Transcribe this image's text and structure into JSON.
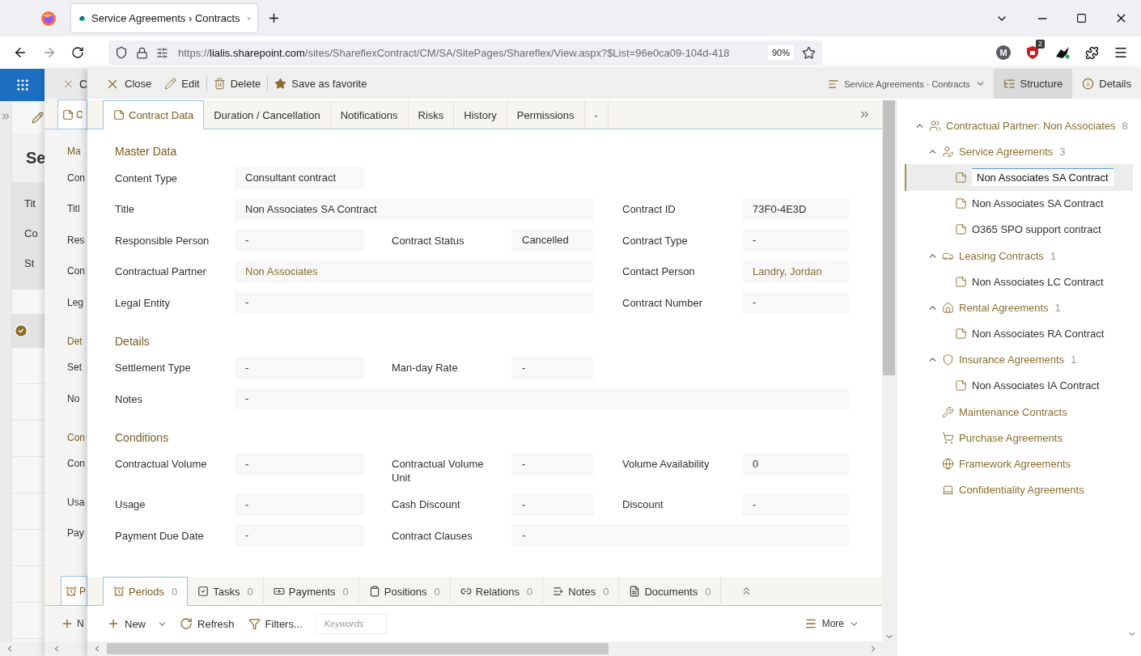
{
  "browser": {
    "tab": {
      "title": "Service Agreements › Contracts",
      "selected": true
    },
    "url": {
      "scheme": "https://",
      "host": "lialis.sharepoint.com",
      "path": "/sites/ShareflexContract/CM/SA/SitePages/Shareflex/View.aspx?$List=96e0ca09-104d-418"
    },
    "zoom": "90%",
    "profile_initial": "M",
    "blocker_count": "2"
  },
  "back_layer": {
    "heading": "Se",
    "rows": [
      "Tit",
      "Co",
      "St"
    ]
  },
  "middle_layer": {
    "toolbar_button": "C",
    "tab": "C",
    "lines": [
      {
        "kind": "heading",
        "text": "Ma"
      },
      {
        "kind": "label",
        "text": "Con"
      },
      {
        "kind": "label",
        "text": "Titl"
      },
      {
        "kind": "label",
        "text": "Res"
      },
      {
        "kind": "label",
        "text": "Con"
      },
      {
        "kind": "label",
        "text": "Leg"
      },
      {
        "kind": "heading",
        "text": "Det"
      },
      {
        "kind": "label",
        "text": "Set"
      },
      {
        "kind": "label",
        "text": "No"
      },
      {
        "kind": "heading",
        "text": "Con"
      },
      {
        "kind": "tall",
        "text": "Con"
      },
      {
        "kind": "label",
        "text": "Usa"
      },
      {
        "kind": "label",
        "text": "Pay"
      }
    ],
    "bottom_tab": "P",
    "new_button": "N"
  },
  "toolbar": {
    "actions": [
      {
        "label": "Close"
      },
      {
        "label": "Edit"
      },
      {
        "label": "Delete"
      },
      {
        "label": "Save as favorite"
      }
    ],
    "view_picker": "Service Agreements · Contracts",
    "panes": [
      {
        "label": "Structure",
        "selected": true
      },
      {
        "label": "Details",
        "selected": false
      }
    ]
  },
  "form_tabs": [
    {
      "label": "Contract Data",
      "selected": true
    },
    {
      "label": "Duration / Cancellation",
      "selected": false
    },
    {
      "label": "Notifications",
      "selected": false
    },
    {
      "label": "Risks",
      "selected": false
    },
    {
      "label": "History",
      "selected": false
    },
    {
      "label": "Permissions",
      "selected": false
    },
    {
      "label": "-",
      "selected": false
    }
  ],
  "sections": [
    {
      "title": "Master Data",
      "rows": [
        [
          {
            "label": "Content Type",
            "value": "Consultant contract",
            "kind": "narrow",
            "link": false
          }
        ],
        [
          {
            "label": "Title",
            "value": "Non Associates SA Contract",
            "kind": "wide",
            "link": false
          },
          {
            "label": "Contract ID",
            "value": "73F0-4E3D",
            "kind": "narrow",
            "link": false
          }
        ],
        [
          {
            "label": "Responsible Person",
            "value": "-",
            "kind": "narrow",
            "link": false
          },
          {
            "label": "Contract Status",
            "value": "Cancelled",
            "kind": "narrow",
            "link": false
          },
          {
            "label": "Contract Type",
            "value": "-",
            "kind": "narrow",
            "link": false
          }
        ],
        [
          {
            "label": "Contractual Partner",
            "value": "Non Associates",
            "kind": "wide",
            "link": true
          },
          {
            "label": "Contact Person",
            "value": "Landry, Jordan",
            "kind": "narrow",
            "link": true
          }
        ],
        [
          {
            "label": "Legal Entity",
            "value": "-",
            "kind": "wide",
            "link": false
          },
          {
            "label": "Contract Number",
            "value": "-",
            "kind": "narrow",
            "link": false
          }
        ]
      ]
    },
    {
      "title": "Details",
      "rows": [
        [
          {
            "label": "Settlement Type",
            "value": "-",
            "kind": "narrow",
            "link": false
          },
          {
            "label": "Man-day Rate",
            "value": "-",
            "kind": "narrow",
            "link": false
          }
        ],
        [
          {
            "label": "Notes",
            "value": "-",
            "kind": "full",
            "link": false
          }
        ]
      ]
    },
    {
      "title": "Conditions",
      "rows": [
        [
          {
            "label": "Contractual Volume",
            "value": "-",
            "kind": "narrow",
            "link": false
          },
          {
            "label": "Contractual Volume Unit",
            "value": "-",
            "kind": "narrow",
            "link": false
          },
          {
            "label": "Volume Availability",
            "value": "0",
            "kind": "narrow",
            "link": false
          }
        ],
        [
          {
            "label": "Usage",
            "value": "-",
            "kind": "narrow",
            "link": false
          },
          {
            "label": "Cash Discount",
            "value": "-",
            "kind": "narrow",
            "link": false
          },
          {
            "label": "Discount",
            "value": "-",
            "kind": "narrow",
            "link": false
          }
        ],
        [
          {
            "label": "Payment Due Date",
            "value": "-",
            "kind": "narrow",
            "link": false
          },
          {
            "label": "Contract Clauses",
            "value": "-",
            "kind": "wide",
            "link": false
          }
        ]
      ]
    }
  ],
  "bottom_tabs": [
    {
      "label": "Periods",
      "count": "0",
      "selected": true
    },
    {
      "label": "Tasks",
      "count": "0",
      "selected": false
    },
    {
      "label": "Payments",
      "count": "0",
      "selected": false
    },
    {
      "label": "Positions",
      "count": "0",
      "selected": false
    },
    {
      "label": "Relations",
      "count": "0",
      "selected": false
    },
    {
      "label": "Notes",
      "count": "0",
      "selected": false
    },
    {
      "label": "Documents",
      "count": "0",
      "selected": false
    }
  ],
  "bottom_toolbar": {
    "new": "New",
    "refresh": "Refresh",
    "filters": "Filters...",
    "search_placeholder": "Keywords",
    "more": "More"
  },
  "tree": [
    {
      "kind": "category",
      "label": "Contractual Partner: Non Associates",
      "count": "8",
      "expanded": true,
      "selected": false,
      "children": [
        {
          "kind": "category",
          "label": "Service Agreements",
          "count": "3",
          "expanded": true,
          "selected": false,
          "children": [
            {
              "kind": "contract",
              "label": "Non Associates SA Contract",
              "selected": true
            },
            {
              "kind": "contract",
              "label": "Non Associates SA Contract",
              "selected": false
            },
            {
              "kind": "contract",
              "label": "O365 SPO support contract",
              "selected": false
            }
          ]
        },
        {
          "kind": "category",
          "label": "Leasing Contracts",
          "count": "1",
          "expanded": true,
          "selected": false,
          "children": [
            {
              "kind": "contract",
              "label": "Non Associates LC Contract",
              "selected": false
            }
          ]
        },
        {
          "kind": "category",
          "label": "Rental Agreements",
          "count": "1",
          "expanded": true,
          "selected": false,
          "children": [
            {
              "kind": "contract",
              "label": "Non Associates RA Contract",
              "selected": false
            }
          ]
        },
        {
          "kind": "category",
          "label": "Insurance Agreements",
          "count": "1",
          "expanded": true,
          "selected": false,
          "children": [
            {
              "kind": "contract",
              "label": "Non Associates IA Contract",
              "selected": false
            }
          ]
        },
        {
          "kind": "category",
          "label": "Maintenance Contracts",
          "selected": false
        },
        {
          "kind": "category",
          "label": "Purchase Agreements",
          "selected": false
        },
        {
          "kind": "category",
          "label": "Framework Agreements",
          "selected": false
        },
        {
          "kind": "category",
          "label": "Confidentiality Agreements",
          "selected": false
        }
      ]
    }
  ]
}
